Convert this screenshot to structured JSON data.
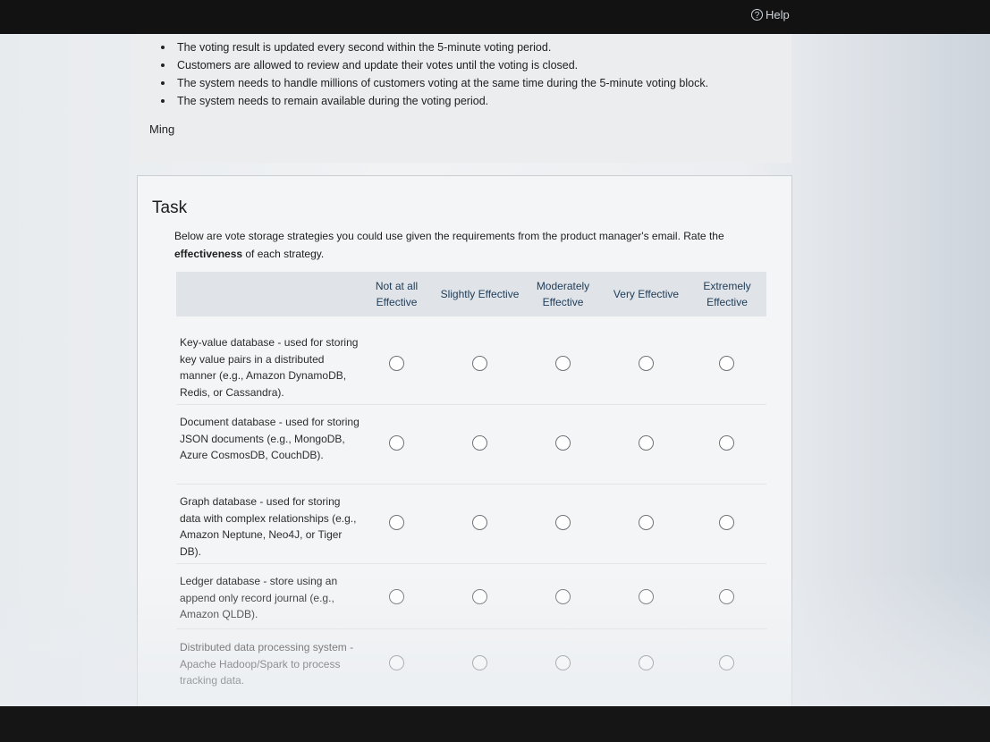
{
  "header": {
    "help_label": "Help",
    "help_icon": "question-circle-icon"
  },
  "email": {
    "bullets": [
      "The voting result is updated every second within the 5-minute voting period.",
      "Customers are allowed to review and update their votes until the voting is closed.",
      "The system needs to handle millions of customers voting at the same time during the 5-minute voting block.",
      "The system needs to remain available during the voting period."
    ],
    "signature": "Ming"
  },
  "task": {
    "title": "Task",
    "instruction_start": "Below are vote storage strategies you could use given the requirements from the product manager's email. Rate the ",
    "instruction_bold": "effectiveness",
    "instruction_end": " of each strategy.",
    "columns": [
      "Not at all Effective",
      "Slightly Effective",
      "Moderately Effective",
      "Very Effective",
      "Extremely Effective"
    ],
    "rows": [
      {
        "label": "Key-value database - used for storing key value pairs in a distributed manner (e.g., Amazon DynamoDB, Redis, or Cassandra).",
        "selected": null
      },
      {
        "label": "Document database - used for storing JSON documents (e.g., MongoDB, Azure CosmosDB, CouchDB).",
        "selected": null
      },
      {
        "label": "Graph database - used for storing data with complex relationships (e.g., Amazon Neptune, Neo4J, or Tiger DB).",
        "selected": null
      },
      {
        "label": "Ledger database - store using an append only record journal (e.g., Amazon QLDB).",
        "selected": null
      },
      {
        "label": "Distributed data processing system - Apache Hadoop/Spark to process tracking data.",
        "selected": null
      }
    ]
  },
  "colors": {
    "header_text": "#1d3b58",
    "table_header_bg": "#e0e4e8",
    "panel_bg": "#f4f5f6"
  }
}
